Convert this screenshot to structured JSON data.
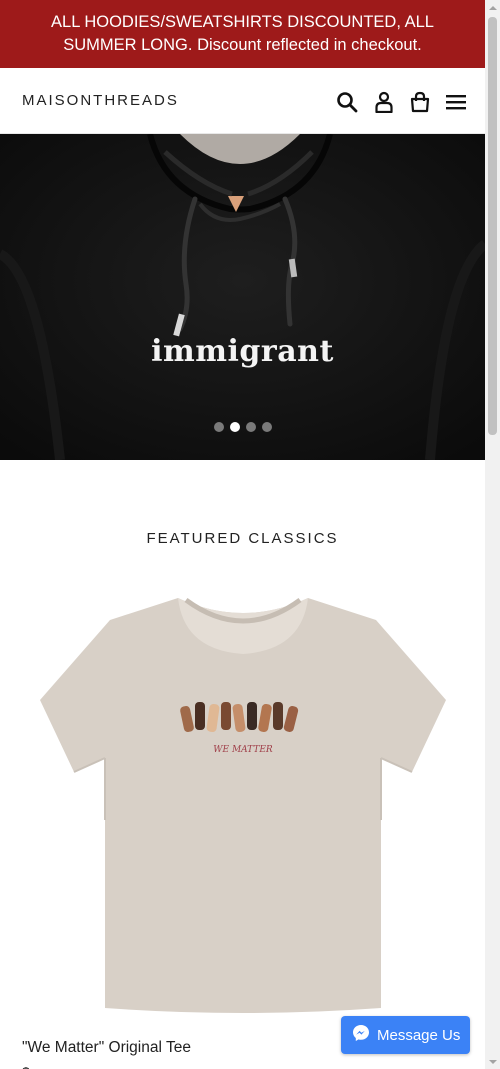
{
  "announcement": {
    "text": "ALL HOODIES/SWEATSHIRTS DISCOUNTED, ALL SUMMER LONG. Discount reflected in checkout."
  },
  "header": {
    "logo": "MAISONTHREADS",
    "icons": [
      "search-icon",
      "account-icon",
      "cart-icon",
      "menu-icon"
    ]
  },
  "hero": {
    "print_text": "immigrant",
    "slides_total": 4,
    "active_slide": 2
  },
  "featured": {
    "title": "FEATURED CLASSICS",
    "product": {
      "print_text": "WE MATTER",
      "title": "\"We Matter\" Original Tee",
      "price": "$"
    }
  },
  "messenger": {
    "label": "Message Us"
  },
  "colors": {
    "announcement_bg": "#9e1a1a",
    "messenger_bg": "#3b82f6",
    "hero_bg": "#121212"
  }
}
